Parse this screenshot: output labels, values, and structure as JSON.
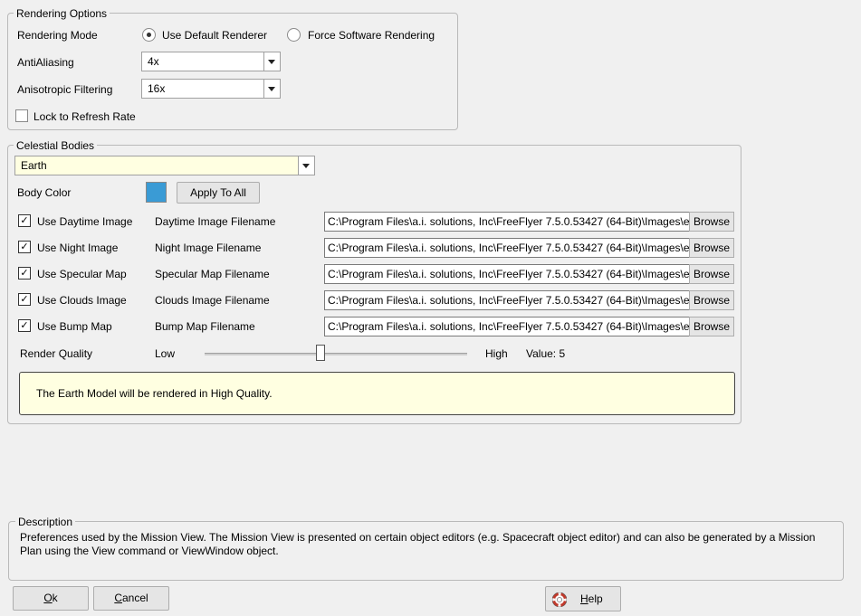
{
  "rendering": {
    "title": "Rendering Options",
    "mode_label": "Rendering Mode",
    "mode_default": "Use Default Renderer",
    "mode_software": "Force Software Rendering",
    "aa_label": "AntiAliasing",
    "aa_value": "4x",
    "aniso_label": "Anisotropic Filtering",
    "aniso_value": "16x",
    "lock_label": "Lock to Refresh Rate",
    "lock_checked": false
  },
  "celestial": {
    "title": "Celestial Bodies",
    "body_value": "Earth",
    "body_color_label": "Body Color",
    "body_color": "#3a9bd5",
    "apply_all": "Apply To All",
    "images": [
      {
        "check_label": "Use Daytime Image",
        "file_label": "Daytime Image Filename",
        "path": "C:\\Program Files\\a.i. solutions, Inc\\FreeFlyer 7.5.0.53427 (64-Bit)\\Images\\ea",
        "browse": "Browse",
        "checked": true
      },
      {
        "check_label": "Use Night Image",
        "file_label": "Night Image Filename",
        "path": "C:\\Program Files\\a.i. solutions, Inc\\FreeFlyer 7.5.0.53427 (64-Bit)\\Images\\ea",
        "browse": "Browse",
        "checked": true
      },
      {
        "check_label": "Use Specular Map",
        "file_label": "Specular Map Filename",
        "path": "C:\\Program Files\\a.i. solutions, Inc\\FreeFlyer 7.5.0.53427 (64-Bit)\\Images\\ea",
        "browse": "Browse",
        "checked": true
      },
      {
        "check_label": "Use Clouds Image",
        "file_label": "Clouds Image Filename",
        "path": "C:\\Program Files\\a.i. solutions, Inc\\FreeFlyer 7.5.0.53427 (64-Bit)\\Images\\ea",
        "browse": "Browse",
        "checked": true
      },
      {
        "check_label": "Use Bump Map",
        "file_label": "Bump Map Filename",
        "path": "C:\\Program Files\\a.i. solutions, Inc\\FreeFlyer 7.5.0.53427 (64-Bit)\\Images\\ea",
        "browse": "Browse",
        "checked": true
      }
    ],
    "quality_label": "Render Quality",
    "quality_low": "Low",
    "quality_high": "High",
    "quality_value_text": "Value: 5",
    "quality_fraction": 0.44,
    "info_text": "The Earth Model will be rendered in High Quality.",
    "info_bg": "#ffffe1"
  },
  "description": {
    "title": "Description",
    "text": "Preferences used by the Mission View.  The Mission View is presented on certain object editors (e.g. Spacecraft object editor) and can also be generated by a Mission Plan using the View command or ViewWindow object."
  },
  "buttons": {
    "ok_first": "O",
    "ok_rest": "k",
    "cancel_first": "C",
    "cancel_rest": "ancel",
    "help_first": "H",
    "help_rest": "elp"
  }
}
